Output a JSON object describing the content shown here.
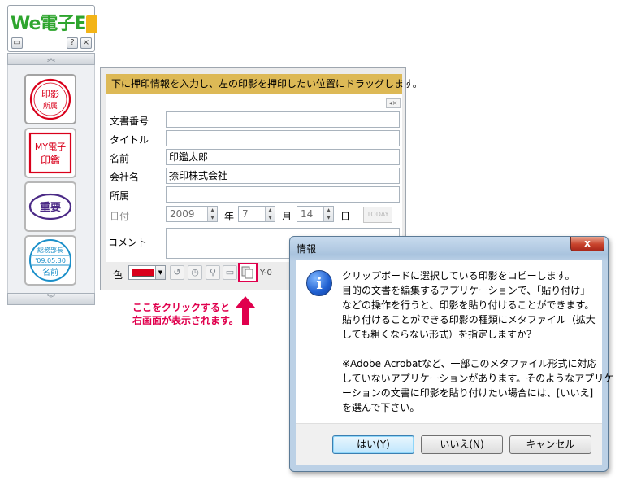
{
  "app": {
    "logo_text": "We電子E",
    "logo_icon": "stamp-logo-icon"
  },
  "palette": {
    "stamps": [
      {
        "name": "round-stamp",
        "lines": [
          "印影",
          "所属"
        ],
        "color": "#d9001b"
      },
      {
        "name": "square-stamp",
        "lines": [
          "MY電子",
          "印鑑"
        ],
        "color": "#d9001b"
      },
      {
        "name": "oval-stamp",
        "lines": [
          "重要"
        ],
        "color": "#4b2a86"
      },
      {
        "name": "date-stamp",
        "lines": [
          "総務部長",
          "'09.05.30",
          "名前"
        ],
        "color": "#1a8fc9"
      }
    ]
  },
  "form": {
    "instruction": "下に押印情報を入力し、左の印影を押印したい位置にドラッグします。",
    "fields": {
      "doc_number_label": "文書番号",
      "doc_number_value": "",
      "title_label": "タイトル",
      "title_value": "",
      "name_label": "名前",
      "name_value": "印鑑太郎",
      "company_label": "会社名",
      "company_value": "捺印株式会社",
      "department_label": "所属",
      "department_value": "",
      "date_label": "日付",
      "year": "2009",
      "year_unit": "年",
      "month": "7",
      "month_unit": "月",
      "day": "14",
      "day_unit": "日",
      "today_button": "TODAY",
      "comment_label": "コメント"
    },
    "toolbar": {
      "color_label": "色",
      "color_value": "#d9001b",
      "y_label": "Y-0"
    }
  },
  "annotation": {
    "line1": "ここをクリックすると",
    "line2": "右画面が表示されます。"
  },
  "dialog": {
    "title": "情報",
    "close": "x",
    "lines": [
      "クリップボードに選択している印影をコピーします。",
      "目的の文書を編集するアプリケーションで、「貼り付け」",
      "などの操作を行うと、印影を貼り付けることができます。",
      "貼り付けることができる印影の種類にメタファイル（拡大",
      "しても粗くならない形式）を指定しますか？",
      "",
      "※Adobe Acrobatなど、一部このメタファイル形式に対応",
      "していないアプリケーションがあります。そのようなアプリケ",
      "ーションの文書に印影を貼り付けたい場合には、[いいえ]",
      "を選んで下さい。"
    ],
    "buttons": {
      "yes": "はい(Y)",
      "no": "いいえ(N)",
      "cancel": "キャンセル"
    }
  }
}
